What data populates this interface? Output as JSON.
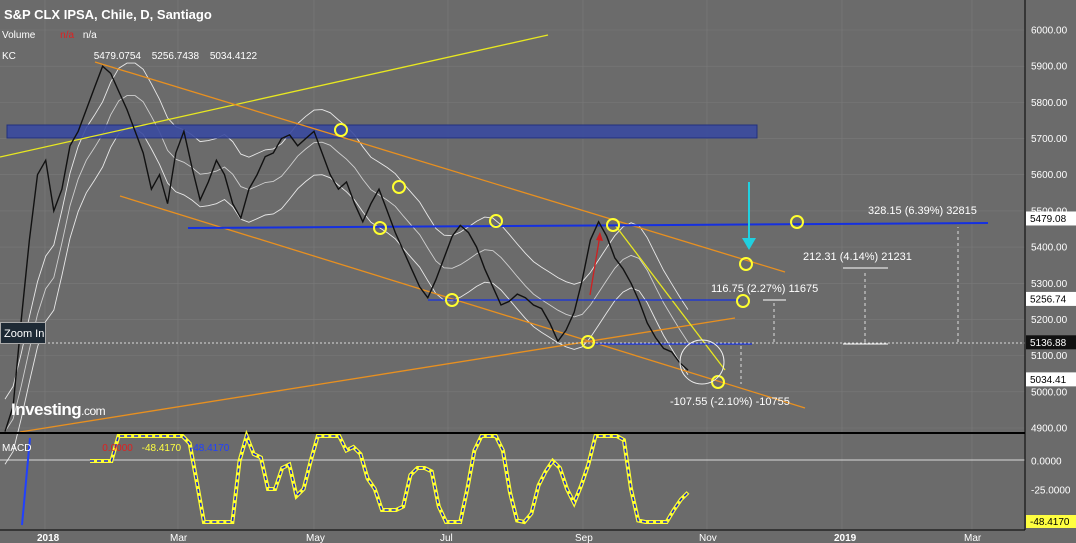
{
  "header": {
    "title": "S&P CLX IPSA, Chile, D, Santiago",
    "volume_label": "Volume",
    "volume_values": [
      "n/a",
      "n/a"
    ],
    "kc_label": "KC",
    "kc_values": [
      "5479.0754",
      "5256.7438",
      "5034.4122"
    ],
    "macd_label": "MACD",
    "macd_values": [
      "0.0000",
      "-48.4170",
      "-48.4170"
    ]
  },
  "zoom_button": "Zoom In",
  "watermark": "Investing",
  "watermark_suffix": ".com",
  "annotations": {
    "target1": "116.75 (2.27%) 11675",
    "target2": "212.31 (4.14%) 21231",
    "target3": "328.15 (6.39%) 32815",
    "downside": "-107.55 (-2.10%) -10755"
  },
  "chart_data": {
    "type": "line",
    "price_axis": {
      "ticks": [
        "6000.00",
        "5900.00",
        "5800.00",
        "5700.00",
        "5600.00",
        "5500.00",
        "5400.00",
        "5300.00",
        "5200.00",
        "5100.00",
        "5000.00",
        "4900.00"
      ],
      "range": [
        4890,
        6040
      ]
    },
    "price_labels": [
      {
        "text": "5479.08",
        "value": 5479.08,
        "style": "light"
      },
      {
        "text": "5256.74",
        "value": 5256.74,
        "style": "light"
      },
      {
        "text": "5136.88",
        "value": 5136.88,
        "style": "dark"
      },
      {
        "text": "5034.41",
        "value": 5034.41,
        "style": "light"
      }
    ],
    "x_ticks": [
      "2018",
      "Mar",
      "May",
      "Jul",
      "Sep",
      "Nov",
      "2019",
      "Mar"
    ],
    "macd_axis": {
      "ticks": [
        "0.0000",
        "-25.0000"
      ],
      "current": "-48.4170"
    },
    "series": [
      {
        "name": "S&P CLX IPSA",
        "values": [
          4890,
          4960,
          5200,
          5420,
          5600,
          5640,
          5500,
          5560,
          5680,
          5720,
          5780,
          5840,
          5900,
          5880,
          5830,
          5780,
          5720,
          5660,
          5560,
          5600,
          5520,
          5660,
          5720,
          5620,
          5530,
          5580,
          5640,
          5600,
          5520,
          5480,
          5560,
          5600,
          5650,
          5660,
          5700,
          5710,
          5680,
          5700,
          5720,
          5660,
          5600,
          5560,
          5580,
          5520,
          5470,
          5520,
          5560,
          5500,
          5440,
          5390,
          5340,
          5290,
          5260,
          5310,
          5370,
          5430,
          5460,
          5440,
          5400,
          5340,
          5290,
          5240,
          5250,
          5270,
          5260,
          5240,
          5230,
          5190,
          5140,
          5170,
          5220,
          5310,
          5420,
          5470,
          5430,
          5370,
          5340,
          5300,
          5250,
          5190,
          5150,
          5120,
          5110,
          5080,
          5060
        ]
      }
    ]
  }
}
